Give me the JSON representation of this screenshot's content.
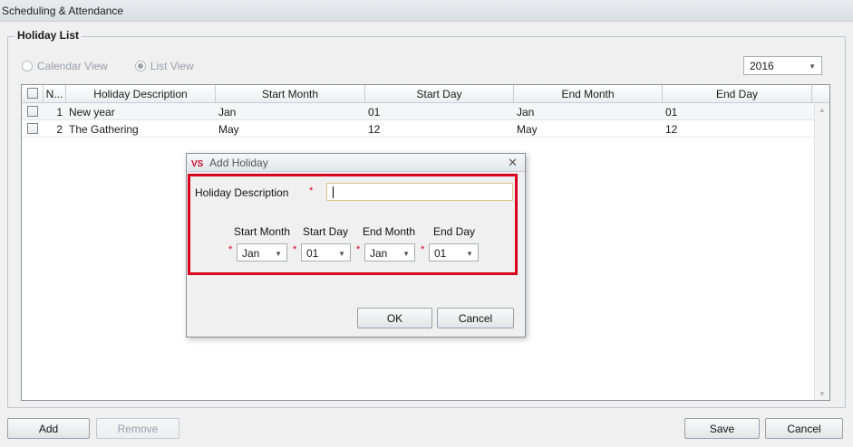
{
  "window": {
    "title": "Scheduling & Attendance"
  },
  "group": {
    "legend": "Holiday List"
  },
  "view_options": {
    "calendar_label": "Calendar View",
    "list_label": "List View",
    "selected": "list"
  },
  "year_select": {
    "value": "2016"
  },
  "table": {
    "columns": [
      "N...",
      "Holiday Description",
      "Start Month",
      "Start Day",
      "End Month",
      "End Day"
    ],
    "rows": [
      {
        "num": "1",
        "description": "New year",
        "start_month": "Jan",
        "start_day": "01",
        "end_month": "Jan",
        "end_day": "01"
      },
      {
        "num": "2",
        "description": "The Gathering",
        "start_month": "May",
        "start_day": "12",
        "end_month": "May",
        "end_day": "12"
      }
    ]
  },
  "footer": {
    "add_label": "Add",
    "remove_label": "Remove",
    "save_label": "Save",
    "cancel_label": "Cancel"
  },
  "dialog": {
    "logo": "VS",
    "title": "Add Holiday",
    "close_glyph": "✕",
    "description_label": "Holiday Description",
    "required_marker": "*",
    "description_value": "",
    "start_month_label": "Start Month",
    "start_day_label": "Start Day",
    "end_month_label": "End Month",
    "end_day_label": "End Day",
    "start_month_value": "Jan",
    "start_day_value": "01",
    "end_month_value": "Jan",
    "end_day_value": "01",
    "ok_label": "OK",
    "cancel_label": "Cancel"
  },
  "colors": {
    "highlight": "#d9001f",
    "required": "#d9001f"
  }
}
